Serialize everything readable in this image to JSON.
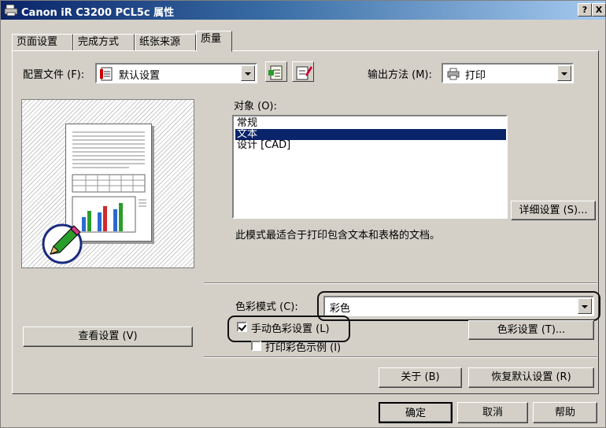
{
  "window": {
    "title": "Canon iR C3200 PCL5c 属性",
    "help_button": "?",
    "close_button": "X"
  },
  "tabs": [
    {
      "label": "页面设置"
    },
    {
      "label": "完成方式"
    },
    {
      "label": "纸张来源"
    },
    {
      "label": "质量",
      "active": true
    }
  ],
  "profile": {
    "label": "配置文件 (F):",
    "value": "默认设置"
  },
  "output": {
    "label": "输出方法 (M):",
    "value": "打印"
  },
  "objective": {
    "label": "对象 (O):",
    "items": [
      "常规",
      "文本",
      "设计 [CAD]"
    ],
    "selected_index": 1,
    "details_button": "详细设置 (S)...",
    "description": "此模式最适合于打印包含文本和表格的文档。"
  },
  "color_mode": {
    "label": "色彩模式 (C):",
    "value": "彩色"
  },
  "manual_color": {
    "label": "手动色彩设置 (L)",
    "checked": true
  },
  "print_sample": {
    "label": "打印彩色示例 (I)",
    "checked": false
  },
  "buttons": {
    "view_settings": "查看设置 (V)",
    "color_settings": "色彩设置 (T)...",
    "about": "关于 (B)",
    "restore_defaults": "恢复默认设置 (R)",
    "ok": "确定",
    "cancel": "取消",
    "help": "帮助"
  },
  "colors": {
    "titlebar_start": "#0a246a",
    "selection": "#0a246a",
    "face": "#d4d0c8"
  }
}
